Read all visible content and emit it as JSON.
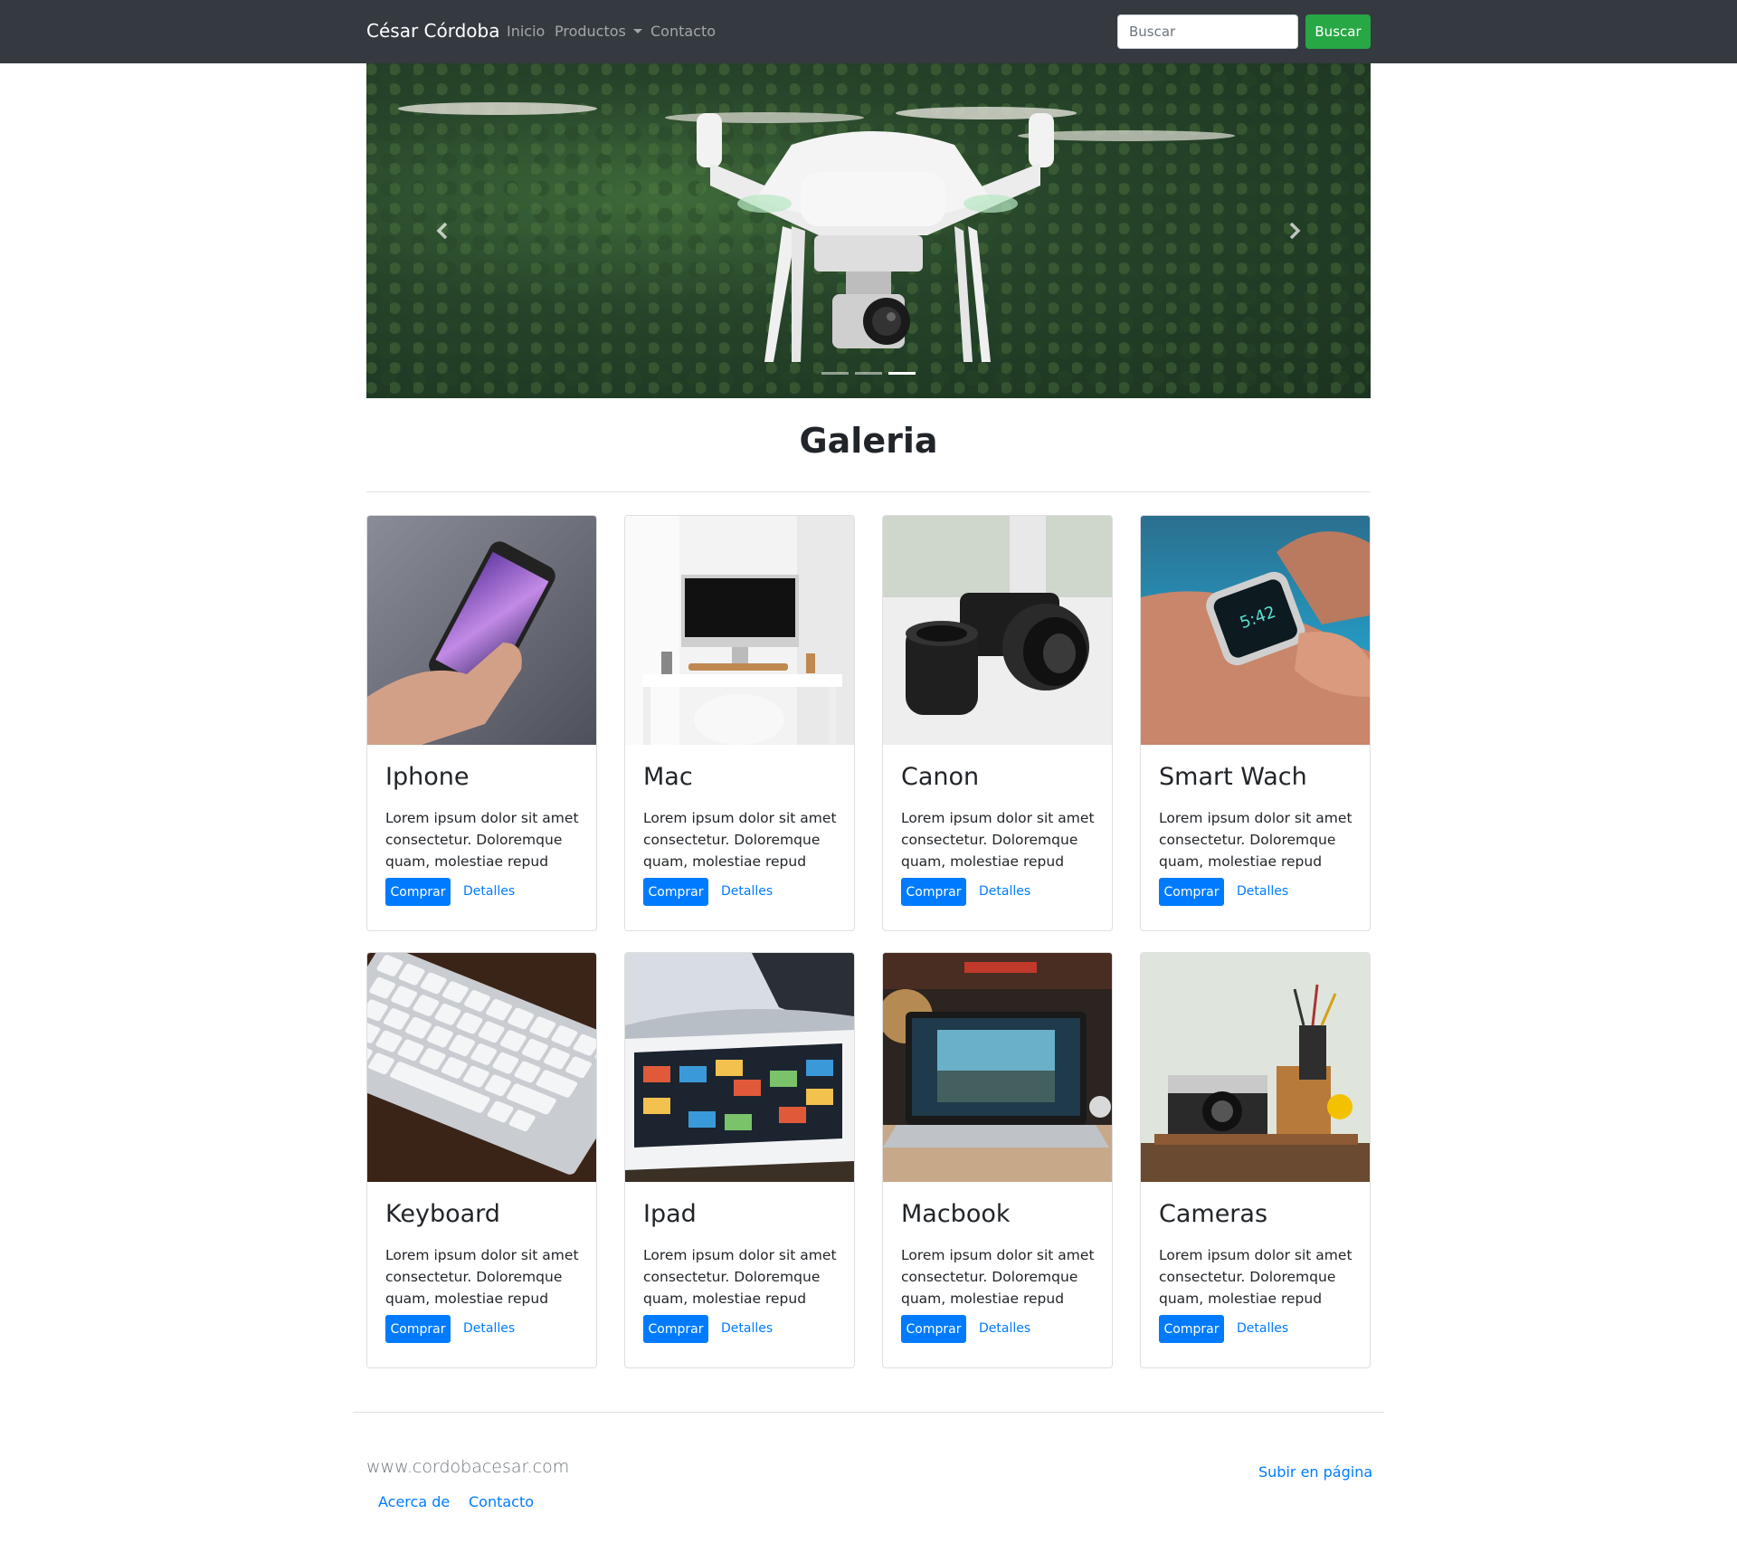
{
  "navbar": {
    "brand": "César Córdoba",
    "links": [
      "Inicio",
      "Productos",
      "Contacto"
    ],
    "search_placeholder": "Buscar",
    "search_button": "Buscar"
  },
  "carousel": {
    "slides": 3,
    "active_slide": 3
  },
  "gallery": {
    "title": "Galeria",
    "cards": [
      {
        "title": "Iphone",
        "text": "Lorem ipsum dolor sit amet consectetur. Doloremque quam, molestiae repud",
        "buy": "Comprar",
        "details": "Detalles"
      },
      {
        "title": "Mac",
        "text": "Lorem ipsum dolor sit amet consectetur. Doloremque quam, molestiae repud",
        "buy": "Comprar",
        "details": "Detalles"
      },
      {
        "title": "Canon",
        "text": "Lorem ipsum dolor sit amet consectetur. Doloremque quam, molestiae repud",
        "buy": "Comprar",
        "details": "Detalles"
      },
      {
        "title": "Smart Wach",
        "text": "Lorem ipsum dolor sit amet consectetur. Doloremque quam, molestiae repud",
        "buy": "Comprar",
        "details": "Detalles"
      },
      {
        "title": "Keyboard",
        "text": "Lorem ipsum dolor sit amet consectetur. Doloremque quam, molestiae repud",
        "buy": "Comprar",
        "details": "Detalles"
      },
      {
        "title": "Ipad",
        "text": "Lorem ipsum dolor sit amet consectetur. Doloremque quam, molestiae repud",
        "buy": "Comprar",
        "details": "Detalles"
      },
      {
        "title": "Macbook",
        "text": "Lorem ipsum dolor sit amet consectetur. Doloremque quam, molestiae repud",
        "buy": "Comprar",
        "details": "Detalles"
      },
      {
        "title": "Cameras",
        "text": "Lorem ipsum dolor sit amet consectetur. Doloremque quam, molestiae repud",
        "buy": "Comprar",
        "details": "Detalles"
      }
    ]
  },
  "footer": {
    "site": "www.cordobacesar.com",
    "links": [
      "Acerca de",
      "Contacto"
    ],
    "back_to_top": "Subir en página"
  },
  "colors": {
    "navbar_bg": "#343a40",
    "primary": "#007bff",
    "success": "#28a745"
  }
}
